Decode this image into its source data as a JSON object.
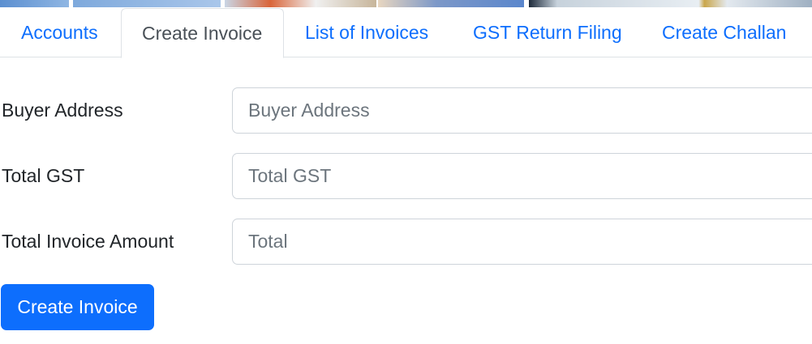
{
  "tabs": [
    {
      "label": "Accounts",
      "active": false
    },
    {
      "label": "Create Invoice",
      "active": true
    },
    {
      "label": "List of Invoices",
      "active": false
    },
    {
      "label": "GST Return Filing",
      "active": false
    },
    {
      "label": "Create Challan",
      "active": false
    }
  ],
  "form": {
    "buyer_address": {
      "label": "Buyer Address",
      "placeholder": "Buyer Address",
      "value": ""
    },
    "total_gst": {
      "label": "Total GST",
      "placeholder": "Total GST",
      "value": ""
    },
    "total_invoice_amount": {
      "label": "Total Invoice Amount",
      "placeholder": "Total",
      "value": ""
    },
    "submit_label": "Create Invoice"
  },
  "colors": {
    "link": "#0d6efd",
    "active_tab_text": "#495057",
    "button_bg": "#0d6efd",
    "border": "#dee2e6"
  }
}
